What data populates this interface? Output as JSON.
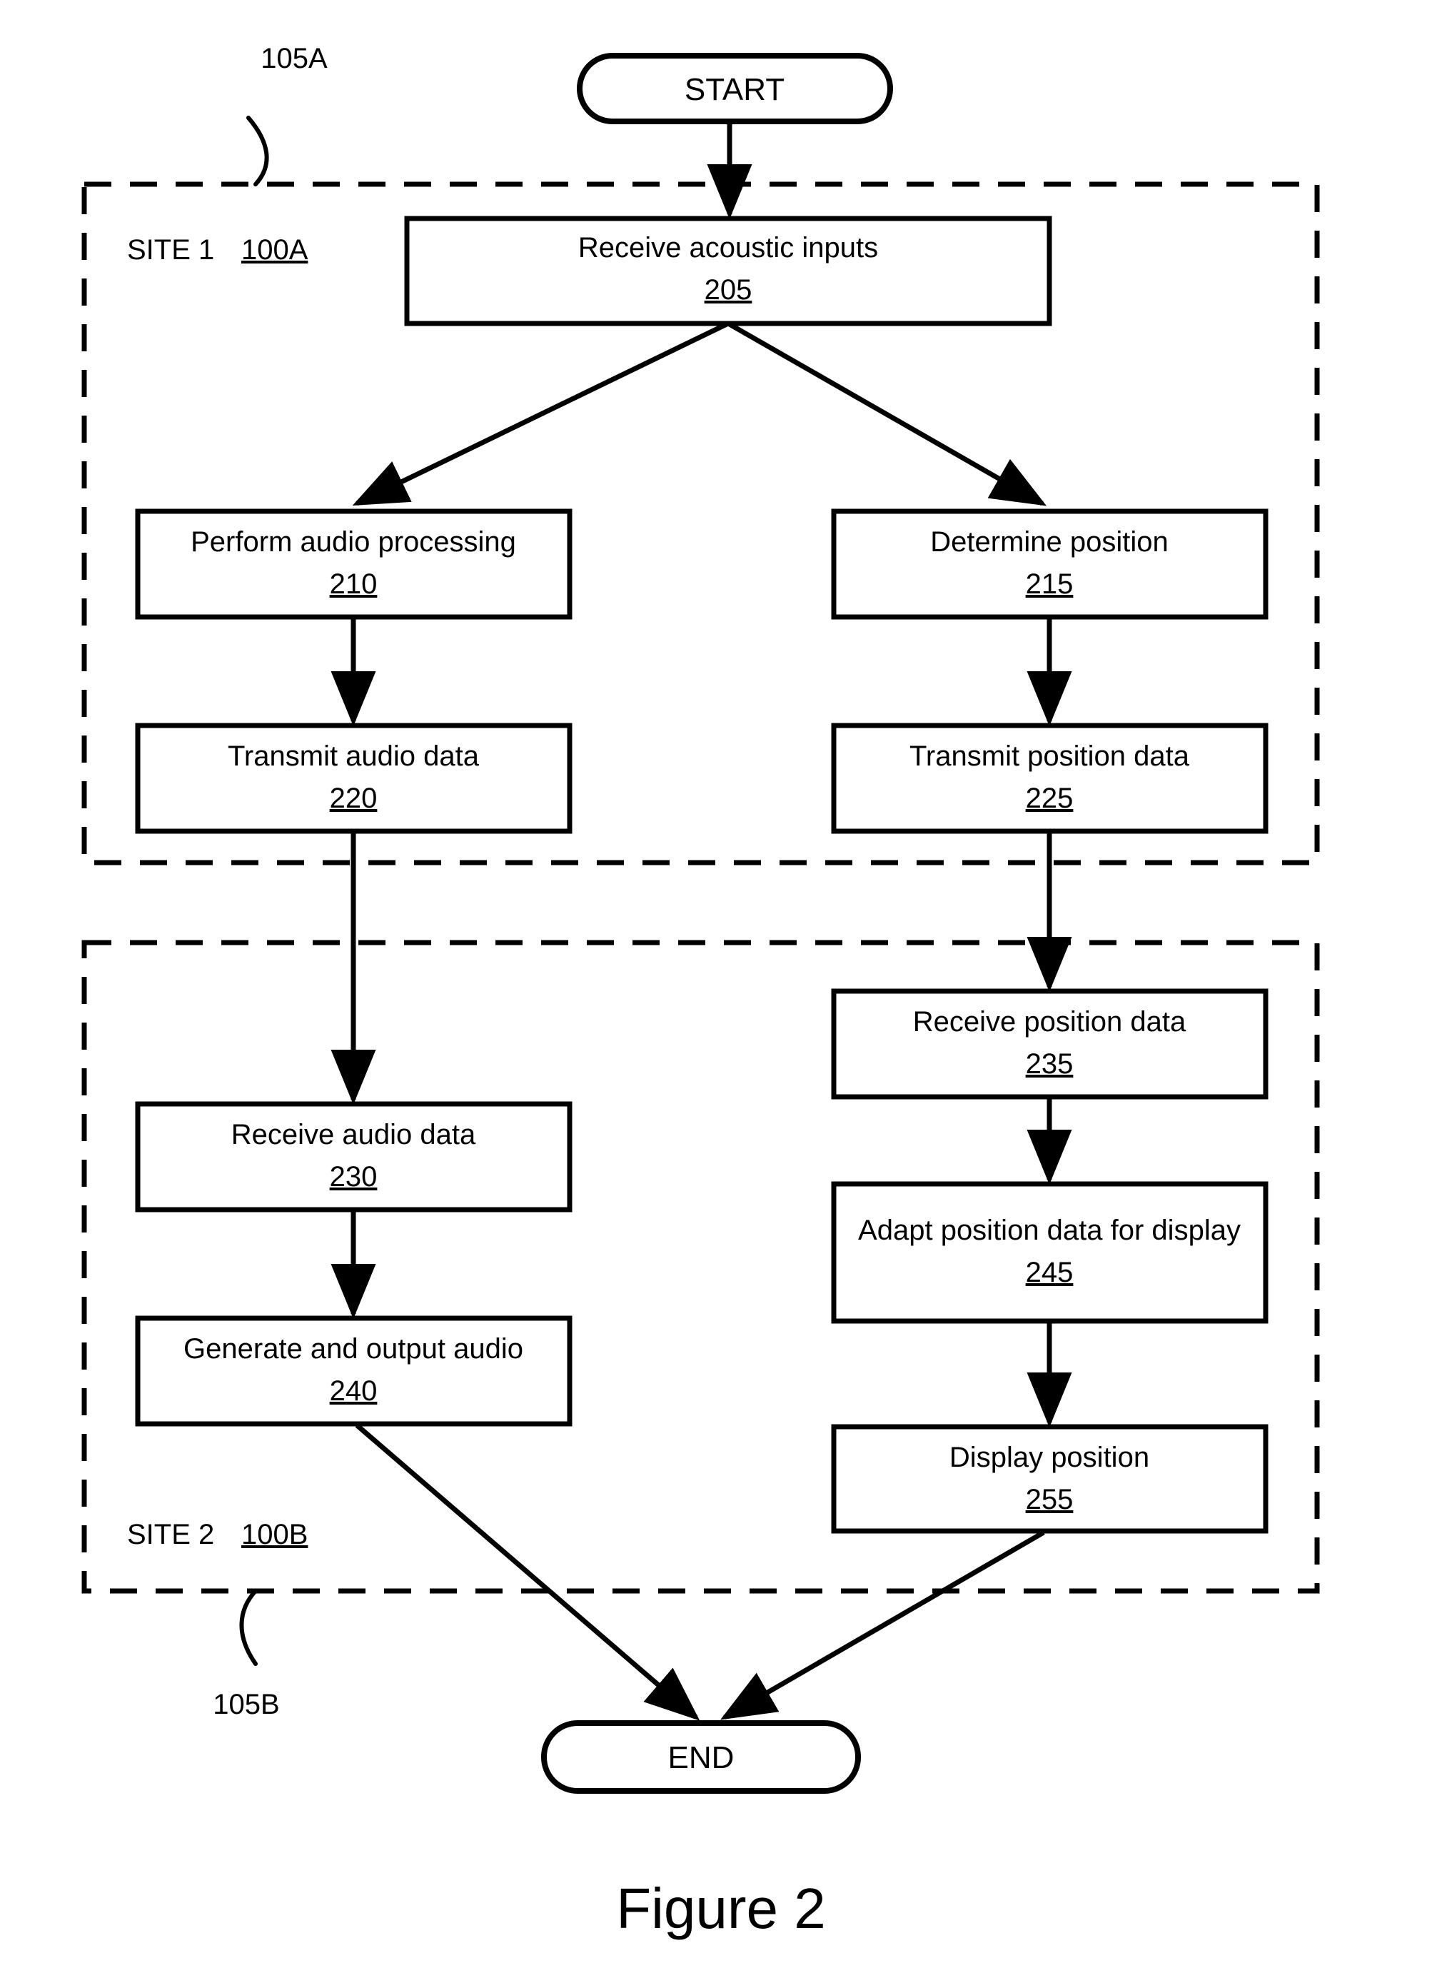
{
  "figure": {
    "caption": "Figure 2"
  },
  "terminals": {
    "start": "START",
    "end": "END"
  },
  "sites": [
    {
      "id": "site-1",
      "label": "SITE 1",
      "ref": "100A",
      "callout": "105A"
    },
    {
      "id": "site-2",
      "label": "SITE 2",
      "ref": "100B",
      "callout": "105B"
    }
  ],
  "steps": [
    {
      "id": "step-205",
      "label": "Receive acoustic inputs",
      "ref": "205"
    },
    {
      "id": "step-210",
      "label": "Perform audio processing",
      "ref": "210"
    },
    {
      "id": "step-215",
      "label": "Determine position",
      "ref": "215"
    },
    {
      "id": "step-220",
      "label": "Transmit audio data",
      "ref": "220"
    },
    {
      "id": "step-225",
      "label": "Transmit position data",
      "ref": "225"
    },
    {
      "id": "step-230",
      "label": "Receive audio data",
      "ref": "230"
    },
    {
      "id": "step-235",
      "label": "Receive position data",
      "ref": "235"
    },
    {
      "id": "step-240",
      "label": "Generate and output audio",
      "ref": "240"
    },
    {
      "id": "step-245",
      "label": "Adapt position data for display",
      "ref": "245"
    },
    {
      "id": "step-255",
      "label": "Display position",
      "ref": "255"
    }
  ],
  "colors": {
    "stroke": "#000000",
    "fill": "#ffffff",
    "background": "#ffffff"
  }
}
